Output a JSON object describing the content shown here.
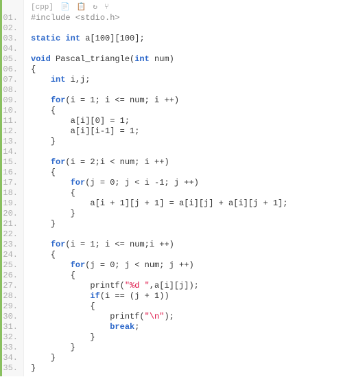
{
  "toolbar": {
    "lang_label": "[cpp]",
    "icons": {
      "copy": "📄",
      "edit": "📋",
      "reload": "↻",
      "branch": "⑂"
    }
  },
  "lines": {
    "l1_pp": "#include <stdio.h>",
    "l2": "",
    "l3_kw1": "static",
    "l3_kw2": "int",
    "l3_rest": " a[100][100];",
    "l4": "",
    "l5_kw1": "void",
    "l5_fn": " Pascal_triangle(",
    "l5_kw2": "int",
    "l5_rest": " num)",
    "l6": "{",
    "l7_ind": "    ",
    "l7_kw": "int",
    "l7_rest": " i,j;",
    "l8": "",
    "l9_ind": "    ",
    "l9_kw": "for",
    "l9_rest": "(i = 1; i <= num; i ++)",
    "l10": "    {",
    "l11": "        a[i][0] = 1;",
    "l12": "        a[i][i-1] = 1;",
    "l13": "    }",
    "l14": "",
    "l15_ind": "    ",
    "l15_kw": "for",
    "l15_rest": "(i = 2;i < num; i ++)",
    "l16": "    {",
    "l17_ind": "        ",
    "l17_kw": "for",
    "l17_rest": "(j = 0; j < i -1; j ++)",
    "l18": "        {",
    "l19": "            a[i + 1][j + 1] = a[i][j] + a[i][j + 1];",
    "l20": "        }",
    "l21": "    }",
    "l22": "",
    "l23_ind": "    ",
    "l23_kw": "for",
    "l23_rest": "(i = 1; i <= num;i ++)",
    "l24": "    {",
    "l25_ind": "        ",
    "l25_kw": "for",
    "l25_rest": "(j = 0; j < num; j ++)",
    "l26": "        {",
    "l27_a": "            printf(",
    "l27_str": "\"%d \"",
    "l27_b": ",a[i][j]);",
    "l28_ind": "            ",
    "l28_kw": "if",
    "l28_rest": "(i == (j + 1))",
    "l29": "            {",
    "l30_a": "                printf(",
    "l30_str": "\"\\n\"",
    "l30_b": ");",
    "l31_ind": "                ",
    "l31_kw": "break",
    "l31_rest": ";",
    "l32": "            }",
    "l33": "        }",
    "l34": "    }",
    "l35": "}"
  },
  "line_numbers": [
    "01.",
    "02.",
    "03.",
    "04.",
    "05.",
    "06.",
    "07.",
    "08.",
    "09.",
    "10.",
    "11.",
    "12.",
    "13.",
    "14.",
    "15.",
    "16.",
    "17.",
    "18.",
    "19.",
    "20.",
    "21.",
    "22.",
    "23.",
    "24.",
    "25.",
    "26.",
    "27.",
    "28.",
    "29.",
    "30.",
    "31.",
    "32.",
    "33.",
    "34.",
    "35."
  ]
}
